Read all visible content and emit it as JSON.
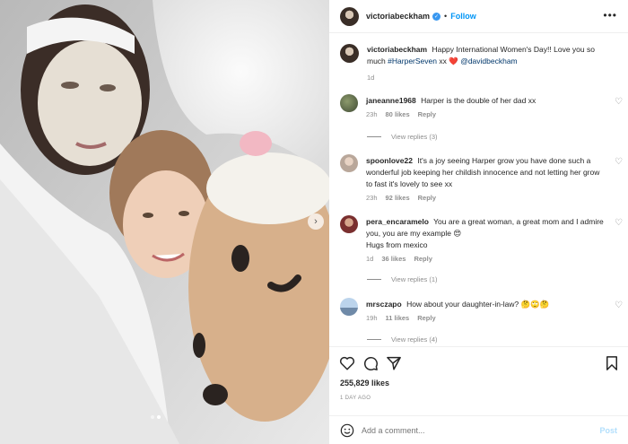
{
  "header": {
    "username": "victoriabeckham",
    "separator": "•",
    "follow_label": "Follow",
    "more_label": "•••"
  },
  "caption": {
    "username": "victoriabeckham",
    "text": "Happy International Women's Day!! Love you so much",
    "hashtag": "#HarperSeven",
    "text_after": "xx",
    "heart": "❤️",
    "mention": "@davidbeckham",
    "time": "1d"
  },
  "comments": [
    {
      "username": "janeanne1968",
      "text": "Harper is the double of her dad xx",
      "time": "23h",
      "likes": "80 likes",
      "reply_label": "Reply",
      "view_replies": "View replies (3)"
    },
    {
      "username": "spoonlove22",
      "text": "It's a joy seeing Harper grow you have done such a wonderful job keeping her childish innocence and not letting her grow to fast it's lovely to see xx",
      "time": "23h",
      "likes": "92 likes",
      "reply_label": "Reply"
    },
    {
      "username": "pera_encaramelo",
      "text": "You are a great woman, a great mom and I admire you, you are my example 😍",
      "text2": "Hugs from mexico",
      "time": "1d",
      "likes": "36 likes",
      "reply_label": "Reply",
      "view_replies": "View replies (1)"
    },
    {
      "username": "mrsczapo",
      "text": "How about your daughter-in-law? 🤔🙄🤔",
      "time": "19h",
      "likes": "11 likes",
      "reply_label": "Reply",
      "view_replies": "View replies (4)"
    }
  ],
  "post": {
    "likes": "255,829 likes",
    "time": "1 DAY AGO"
  },
  "add_comment": {
    "placeholder": "Add a comment...",
    "post_label": "Post"
  },
  "icons": {
    "like": "heart-outline-icon",
    "comment": "speech-bubble-icon",
    "share": "paper-plane-icon",
    "save": "bookmark-icon",
    "emoji": "smiley-icon",
    "comment_like": "small-heart-icon",
    "next": "chevron-right-icon"
  },
  "colors": {
    "link": "#00376b",
    "follow": "#0095f6",
    "muted": "#8e8e8e",
    "verified": "#3897f0",
    "post_disabled": "#b2dffc"
  },
  "carousel": {
    "active_index": 1,
    "count": 2
  }
}
